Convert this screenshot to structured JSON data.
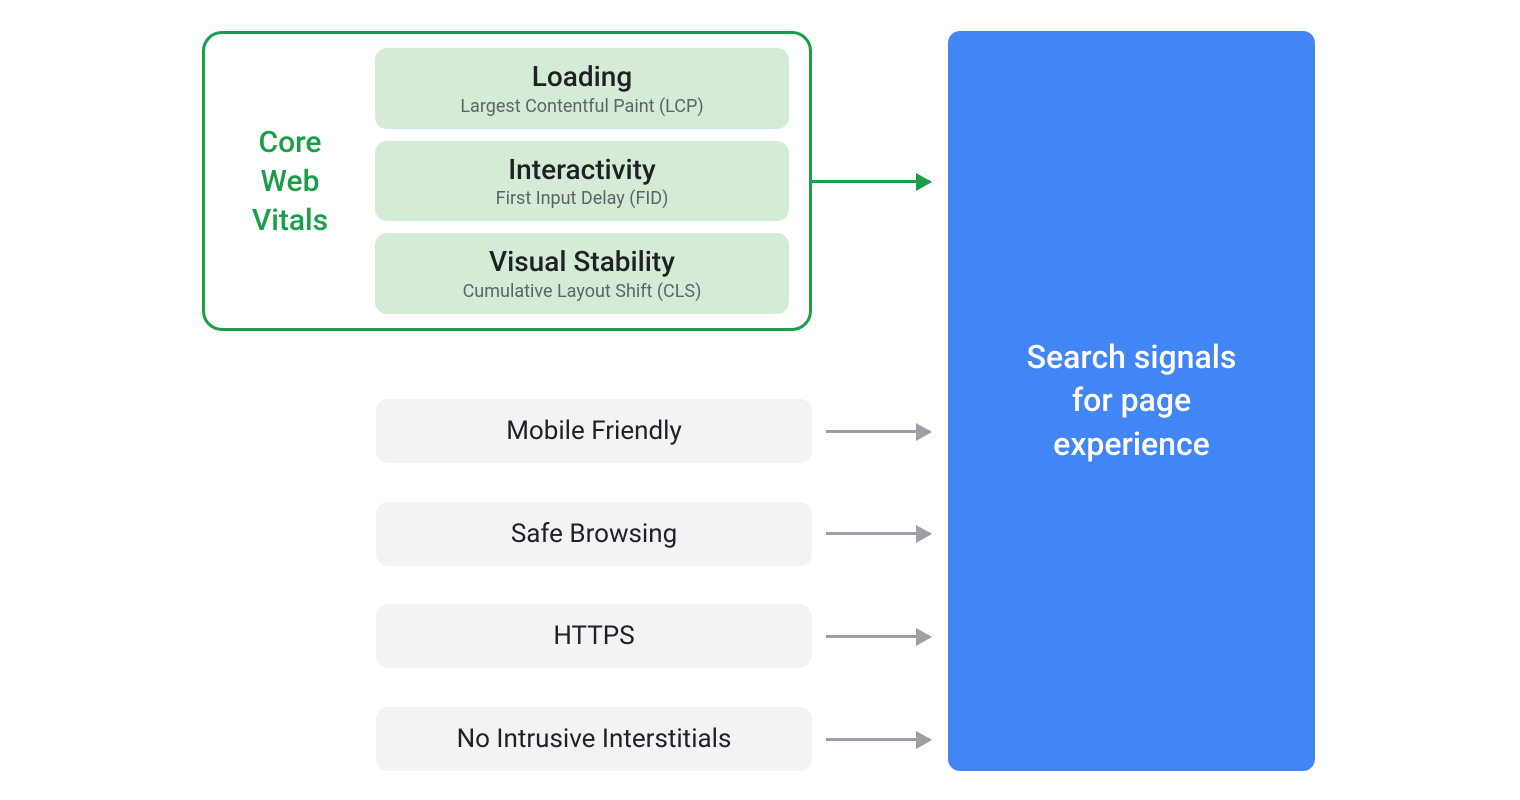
{
  "coreVitals": {
    "label_line1": "Core",
    "label_line2": "Web",
    "label_line3": "Vitals",
    "items": [
      {
        "title": "Loading",
        "subtitle": "Largest Contentful Paint (LCP)"
      },
      {
        "title": "Interactivity",
        "subtitle": "First Input Delay (FID)"
      },
      {
        "title": "Visual Stability",
        "subtitle": "Cumulative Layout Shift (CLS)"
      }
    ]
  },
  "signals": {
    "mobile": "Mobile Friendly",
    "safe": "Safe Browsing",
    "https": "HTTPS",
    "interstitials": "No Intrusive Interstitials"
  },
  "destination": {
    "line1": "Search signals",
    "line2": "for page",
    "line3": "experience"
  },
  "colors": {
    "green": "#1a9e4a",
    "greenFill": "#d4ecd6",
    "grayFill": "#f1f3f4",
    "blue": "#4285f4",
    "grayArrow": "#9aa0a6"
  }
}
